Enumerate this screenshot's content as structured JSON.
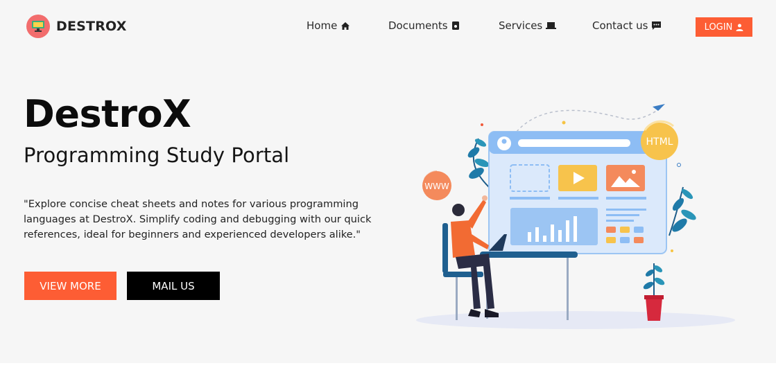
{
  "brand": {
    "name": "DESTROX"
  },
  "nav": {
    "items": [
      {
        "label": "Home",
        "icon": "home-icon"
      },
      {
        "label": "Documents",
        "icon": "document-icon"
      },
      {
        "label": "Services",
        "icon": "laptop-icon"
      },
      {
        "label": "Contact us",
        "icon": "chat-icon"
      }
    ],
    "login_label": "LOGIN",
    "login_icon": "user-icon"
  },
  "hero": {
    "title": "DestroX",
    "subtitle": "Programming Study Portal",
    "description": "\"Explore concise cheat sheets and notes for various programming languages at DestroX. Simplify coding and debugging with our quick references, ideal for beginners and experienced developers alike.\"",
    "primary_button": "VIEW MORE",
    "secondary_button": "MAIL US"
  },
  "illustration": {
    "badge_html": "HTML",
    "badge_www": "WWW"
  },
  "colors": {
    "accent": "#fd5d34",
    "background": "#f6f6f6",
    "dark_button": "#000000"
  }
}
